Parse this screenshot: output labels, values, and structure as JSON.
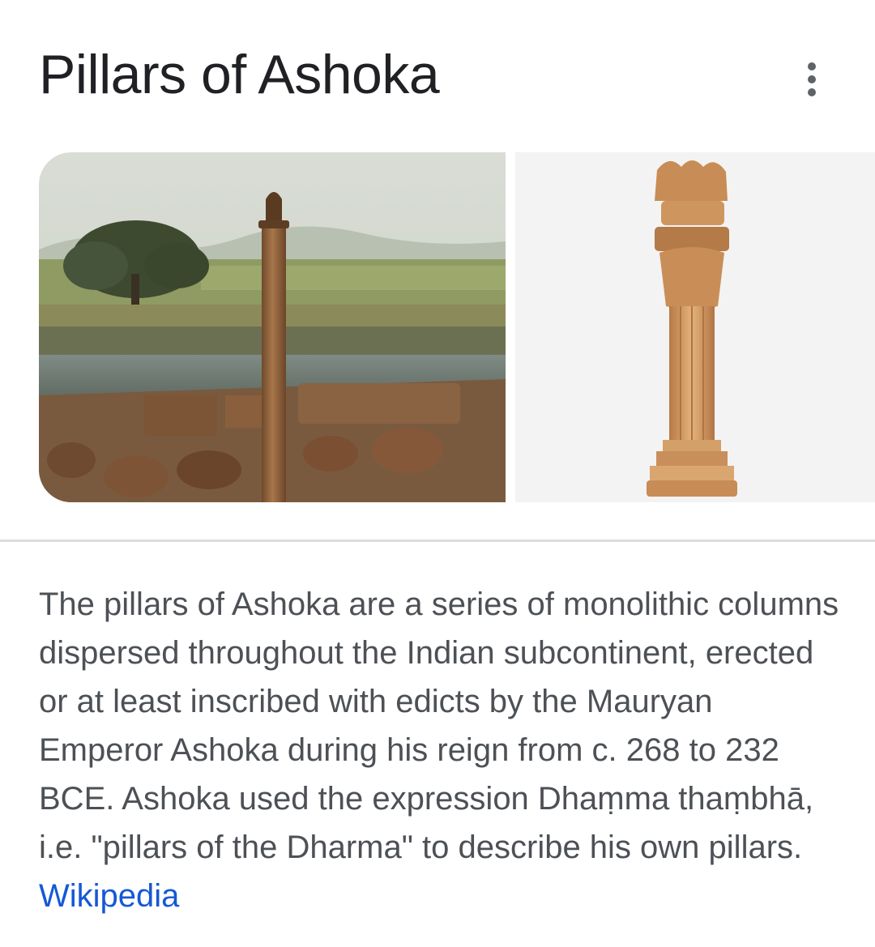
{
  "header": {
    "title": "Pillars of Ashoka",
    "menu_icon": "more-vert-icon"
  },
  "images": [
    {
      "name": "pillar-at-vaishali-photo",
      "kind": "photo"
    },
    {
      "name": "lion-capital-carving-photo",
      "kind": "photo"
    }
  ],
  "description": {
    "text": "The pillars of Ashoka are a series of monolithic columns dispersed throughout the Indian subcontinent, erected or at least inscribed with edicts by the Mauryan Emperor Ashoka during his reign from c. 268 to 232 BCE. Ashoka used the expression Dhaṃma thaṃbhā, i.e. \"pillars of the Dharma\" to describe his own pillars.",
    "source_link": "Wikipedia"
  },
  "colors": {
    "title": "#202124",
    "body_text": "#4d5156",
    "link": "#1558d6",
    "divider": "#dadce0"
  }
}
